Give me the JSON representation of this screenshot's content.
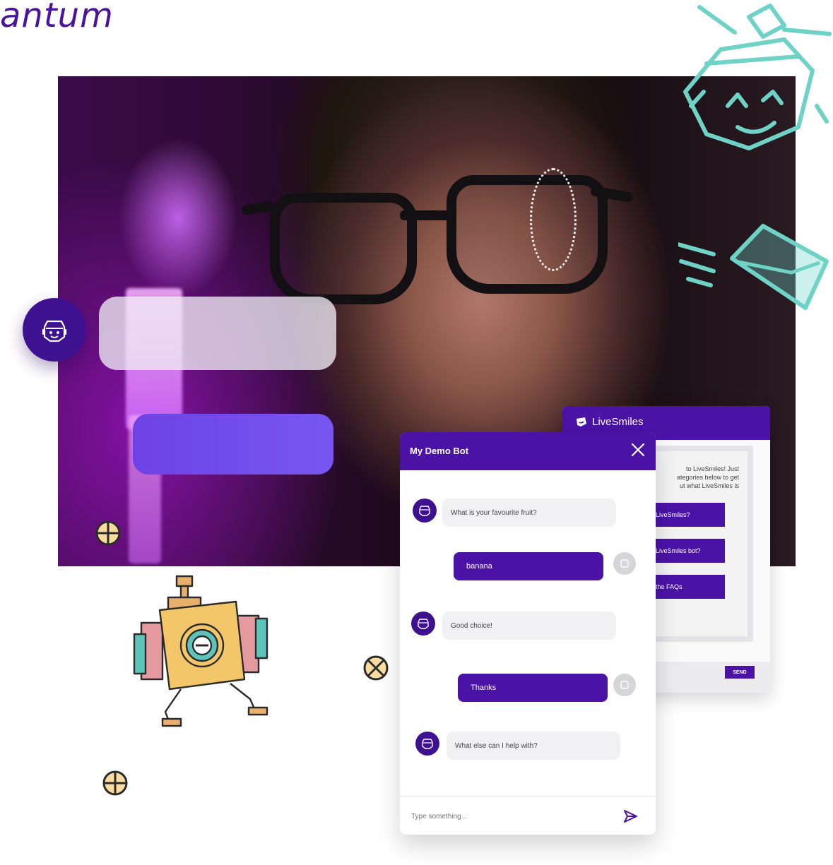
{
  "brand_word": "antum",
  "back_widget": {
    "brand": "LiveSmiles",
    "intro_lines": [
      "to LiveSmiles! Just",
      "ategories below to get",
      "ut what LiveSmiles is"
    ],
    "options": [
      "LiveSmiles?",
      "LiveSmiles bot?",
      "the FAQs"
    ],
    "send_label": "SEND"
  },
  "chat": {
    "title": "My Demo Bot",
    "messages": [
      {
        "from": "bot",
        "text": "What is your favourite fruit?"
      },
      {
        "from": "user",
        "text": "banana"
      },
      {
        "from": "bot",
        "text": "Good choice!"
      },
      {
        "from": "user",
        "text": "Thanks"
      },
      {
        "from": "bot",
        "text": "What else can I help with?"
      }
    ],
    "input_placeholder": "Type something..."
  },
  "colors": {
    "primary": "#4a13a6",
    "avatar": "#3d1190",
    "accent_violet": "#6d43e6",
    "teal_line": "#6ed3c6",
    "bot_bubble": "#f1f1f3"
  },
  "icons": {
    "close": "close-icon",
    "send": "send-icon",
    "bot": "robot-face-icon",
    "user": "user-avatar-icon"
  }
}
